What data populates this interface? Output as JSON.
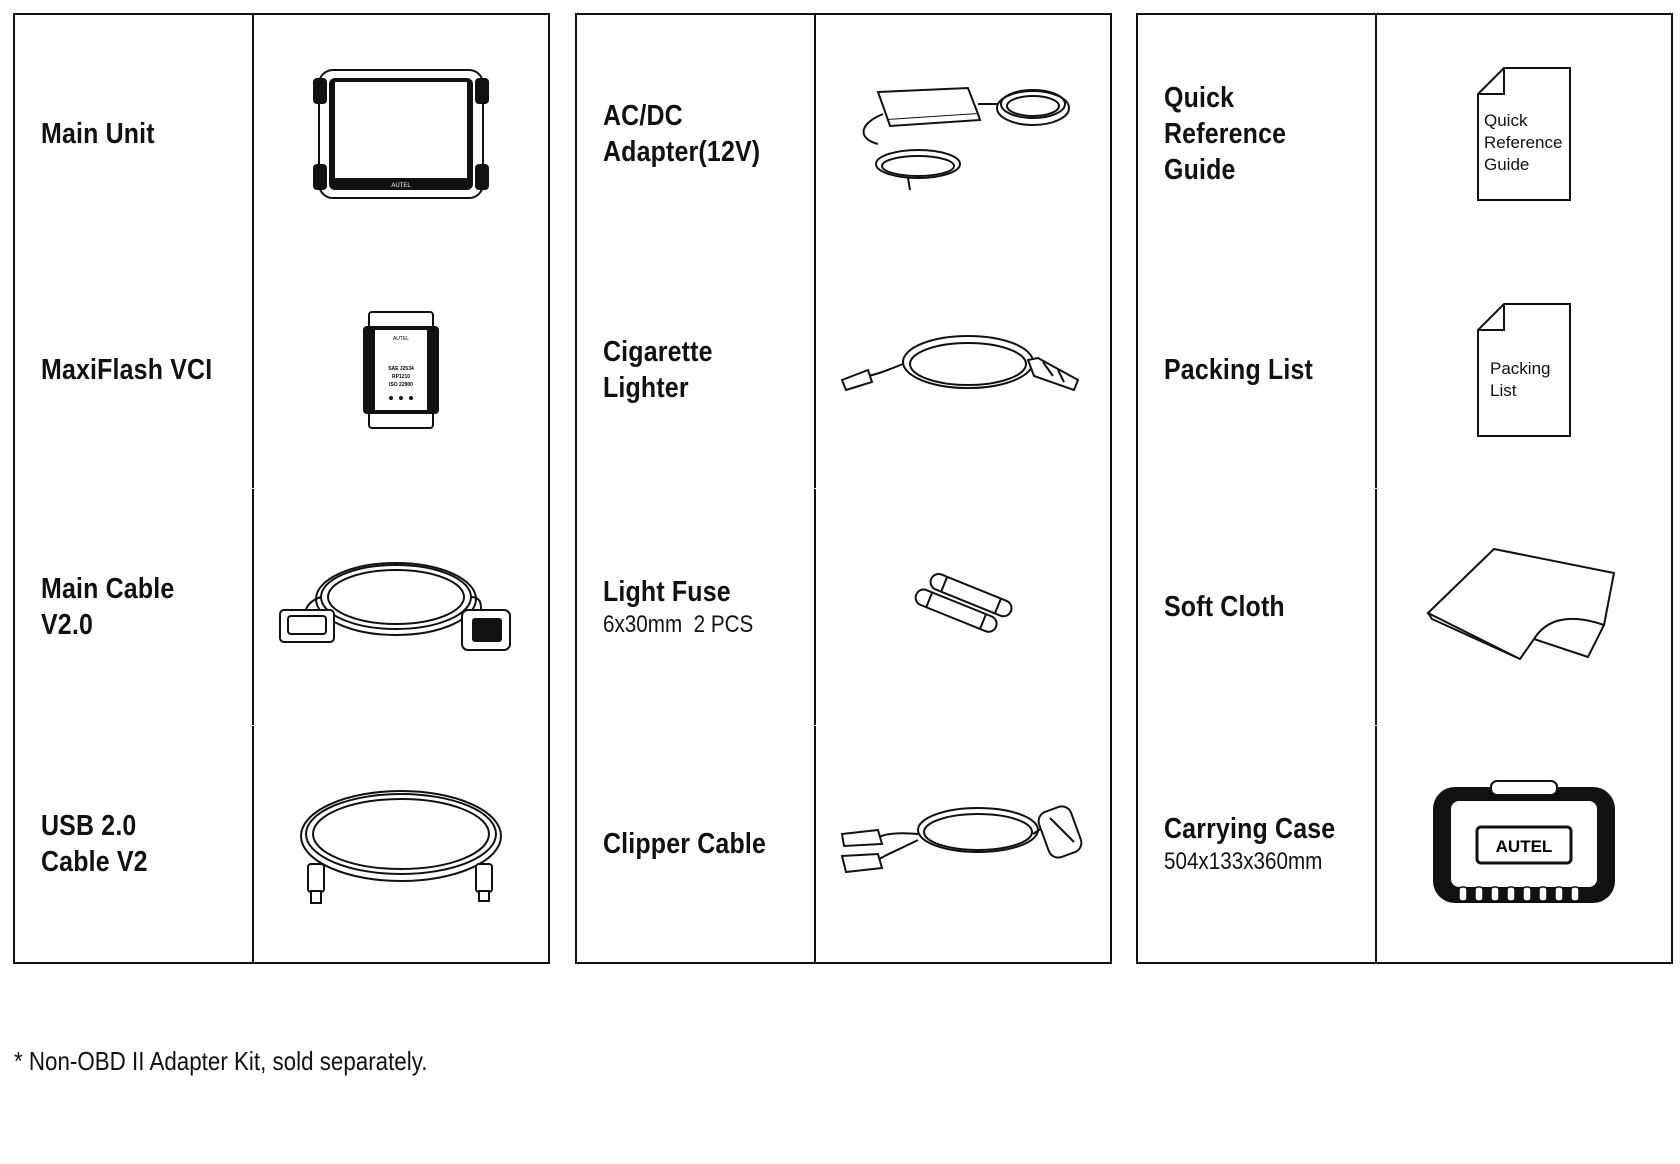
{
  "tables": [
    {
      "items": [
        {
          "name": "Main Unit",
          "sub": "",
          "icon": "tablet-icon"
        },
        {
          "name": "MaxiFlash VCI",
          "sub": "",
          "icon": "vci-device-icon"
        },
        {
          "name": "Main Cable V2.0",
          "sub": "",
          "icon": "obd-cable-icon"
        },
        {
          "name": "USB 2.0\nCable V2",
          "sub": "",
          "icon": "usb-cable-icon"
        }
      ]
    },
    {
      "items": [
        {
          "name": "AC/DC\nAdapter(12V)",
          "sub": "",
          "icon": "power-adapter-icon"
        },
        {
          "name": "Cigarette Lighter",
          "sub": "",
          "icon": "cigarette-lighter-cable-icon"
        },
        {
          "name": "Light Fuse",
          "sub": "6x30mm  2 PCS",
          "icon": "fuses-icon"
        },
        {
          "name": "Clipper Cable",
          "sub": "",
          "icon": "clipper-cable-icon"
        }
      ]
    },
    {
      "items": [
        {
          "name": "Quick Reference\nGuide",
          "sub": "",
          "icon": "document-icon"
        },
        {
          "name": "Packing List",
          "sub": "",
          "icon": "document-icon"
        },
        {
          "name": "Soft Cloth",
          "sub": "",
          "icon": "cloth-icon"
        },
        {
          "name": "Carrying Case",
          "sub": "504x133x360mm",
          "icon": "carrying-case-icon"
        }
      ]
    }
  ],
  "illustration_text": {
    "qrg_doc": [
      "Quick",
      "Reference",
      "Guide"
    ],
    "packing_doc": [
      "Packing",
      "List"
    ],
    "case_brand": "AUTEL",
    "tablet_brand": "AUTEL",
    "vci_brand": "AUTEL",
    "vci_label": [
      "SAE J2534",
      "RP1210",
      "ISO 22900"
    ]
  },
  "footnote": "* Non-OBD II Adapter Kit, sold separately."
}
